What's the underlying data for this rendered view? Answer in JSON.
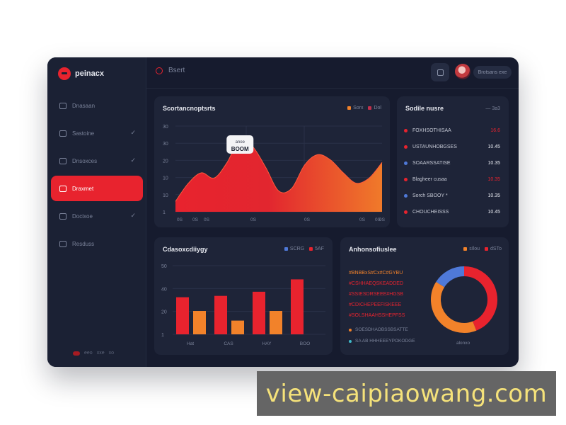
{
  "colors": {
    "accent": "#e8232e",
    "orange": "#f2822a",
    "blue": "#4f79d8",
    "panel": "#1e2438",
    "window": "#161b2e"
  },
  "app": {
    "logo": "peinacx"
  },
  "sidebar": {
    "items": [
      {
        "label": "Dnasaan",
        "icon": "circle-icon",
        "check": ""
      },
      {
        "label": "Sastoine",
        "icon": "calendar-icon",
        "check": "✓"
      },
      {
        "label": "Dnsoxces",
        "icon": "image-icon",
        "check": "✓"
      },
      {
        "label": "Draxmet",
        "icon": "document-icon",
        "check": ""
      },
      {
        "label": "Docixoe",
        "icon": "bookmark-icon",
        "check": "✓"
      },
      {
        "label": "Resduss",
        "icon": "folder-icon",
        "check": ""
      }
    ],
    "footer": [
      "eeo",
      "xxe",
      "xo"
    ]
  },
  "topbar": {
    "search_text": "Bsert",
    "user_label": "Brotsans exe"
  },
  "area_card": {
    "title": "Scortancnoptsrts",
    "legend": [
      "Sorx",
      "Dol"
    ],
    "tooltip_top": "anoe",
    "tooltip_value": "BOOM",
    "chart_data": {
      "type": "area",
      "yticks": [
        "30",
        "30",
        "20",
        "10",
        "10",
        "1"
      ],
      "xticks": [
        "0S",
        "0S",
        "0S",
        "0S",
        "0S",
        "0S",
        "0S",
        "0S"
      ],
      "x": [
        0,
        1,
        2,
        3,
        4,
        5,
        6,
        7,
        8,
        9,
        10,
        11,
        12,
        13,
        14,
        15,
        16
      ],
      "values": [
        4,
        11,
        15,
        13,
        19,
        28,
        25,
        17,
        8,
        9,
        18,
        22,
        20,
        15,
        11,
        13,
        19
      ],
      "ylim": [
        0,
        33
      ]
    }
  },
  "list_card": {
    "title": "Sodile nusre",
    "meta": "— 3a3",
    "rows": [
      {
        "name": "FOXHSOTHISAA",
        "value": "16.6",
        "color": "#e8232e",
        "hot": true
      },
      {
        "name": "USTAUNHOBGSES",
        "value": "10.45",
        "color": "#e8232e",
        "hot": false
      },
      {
        "name": "SOAARSSATISE",
        "value": "10.35",
        "color": "#4f79d8",
        "hot": false
      },
      {
        "name": "Blagheer cusaa",
        "value": "10.35",
        "color": "#e8232e",
        "hot": true
      },
      {
        "name": "Sorch SBOOY *",
        "value": "10.35",
        "color": "#4f79d8",
        "hot": false
      },
      {
        "name": "CHOUCHEISSS",
        "value": "10.45",
        "color": "#e8232e",
        "hot": false
      }
    ]
  },
  "bar_card": {
    "title": "Cdasoxcdiiygy",
    "legend": [
      "SCRG",
      "5AF"
    ],
    "chart_data": {
      "type": "bar",
      "yticks": [
        "50",
        "40",
        "20",
        "1"
      ],
      "categories": [
        "Hat",
        "CAS",
        "HAY",
        "BOO"
      ],
      "series": [
        {
          "name": "SCRG",
          "values": [
            27,
            28,
            31,
            40
          ]
        },
        {
          "name": "5AF",
          "values": [
            17,
            10,
            17,
            0
          ]
        }
      ],
      "ylim": [
        0,
        50
      ]
    }
  },
  "donut_card": {
    "title": "Anhonsofiuslee",
    "legend": [
      "sIlou",
      "dSTo"
    ],
    "lines": [
      {
        "text": "#BNBBxS#Cx#C#GYBU",
        "tone": "or"
      },
      {
        "text": "#CSHHAEQSKEADDED",
        "tone": "rd"
      },
      {
        "text": "#SSIESDRSEEE#HGSB",
        "tone": "rd"
      },
      {
        "text": "#CDICHEPEEFISKEEE",
        "tone": "rd"
      },
      {
        "text": "#SOLSHAAHSSHEPFSS",
        "tone": "rd"
      }
    ],
    "foot1": "SOESDHAOBSSBSATTE",
    "foot2": "SA  AB HHHEEEYPOKODGE",
    "caption": "alonxo",
    "chart_data": {
      "type": "pie",
      "labels": [
        "Red",
        "Orange",
        "Blue"
      ],
      "values": [
        44,
        40,
        16
      ]
    }
  },
  "watermark": "view-caipiaowang.com"
}
